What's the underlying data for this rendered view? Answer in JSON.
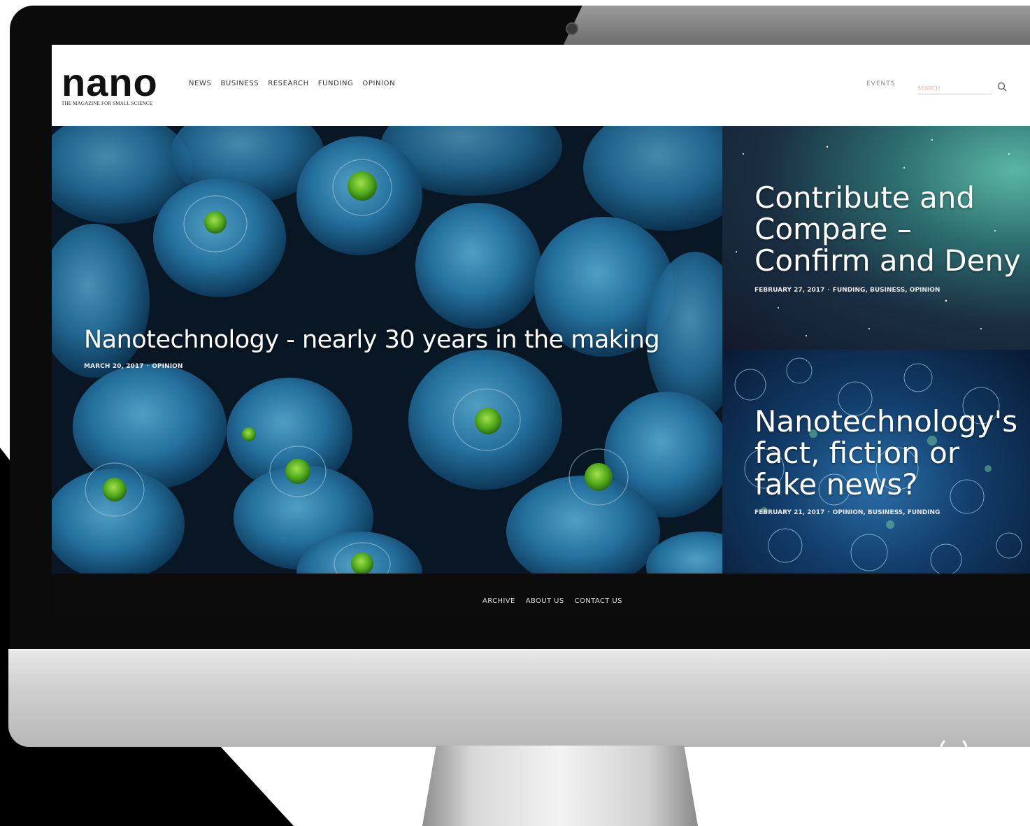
{
  "header": {
    "logo": "nano",
    "logo_tagline": "The Magazine for Small Science",
    "nav": [
      "NEWS",
      "BUSINESS",
      "RESEARCH",
      "FUNDING",
      "OPINION"
    ],
    "events": "EVENTS",
    "search_placeholder": "SEARCH"
  },
  "featured": {
    "title": "Nanotechnology - nearly 30 years in the making",
    "date": "MARCH 20, 2017",
    "categories": "OPINION"
  },
  "side_stories": [
    {
      "title": "Contribute and Compare – Confirm and Deny",
      "date": "FEBRUARY 27, 2017",
      "categories": "FUNDING, BUSINESS, OPINION"
    },
    {
      "title": "Nanotechnology's fact, fiction or fake news?",
      "date": "FEBRUARY 21, 2017",
      "categories": "OPINION, BUSINESS, FUNDING"
    }
  ],
  "footer": {
    "links": [
      "ARCHIVE",
      "ABOUT US",
      "CONTACT US"
    ]
  },
  "colors": {
    "hero_blue": "#1e6f9f",
    "cell_green": "#6fd12a",
    "footer_bg": "#0c0c0c"
  }
}
